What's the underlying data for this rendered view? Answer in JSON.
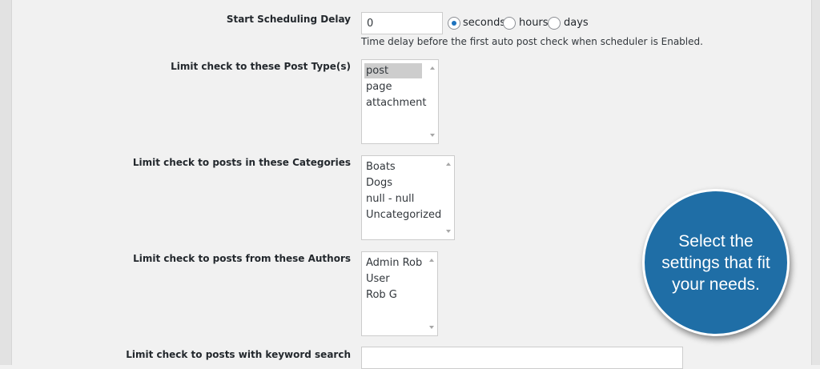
{
  "scheduling": {
    "label": "Start Scheduling Delay",
    "value": "0",
    "units": [
      {
        "label": "seconds",
        "checked": true
      },
      {
        "label": "hours",
        "checked": false
      },
      {
        "label": "days",
        "checked": false
      }
    ],
    "description": "Time delay before the first auto post check when scheduler is Enabled."
  },
  "post_types": {
    "label": "Limit check to these Post Type(s)",
    "options": [
      "post",
      "page",
      "attachment"
    ],
    "selected": "post"
  },
  "categories": {
    "label": "Limit check to posts in these Categories",
    "options": [
      "Boats",
      "Dogs",
      "null - null",
      "Uncategorized"
    ]
  },
  "authors": {
    "label": "Limit check to posts from these Authors",
    "options": [
      "Admin Rob",
      "User",
      "Rob G"
    ]
  },
  "keyword": {
    "label": "Limit check to posts with keyword search",
    "value": ""
  },
  "callout": {
    "text": "Select the settings that fit your needs.",
    "color": "#1f6ea6"
  }
}
